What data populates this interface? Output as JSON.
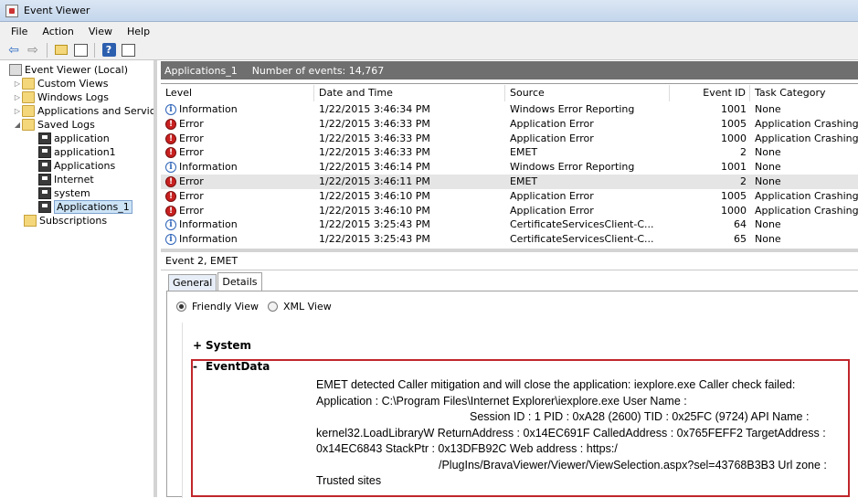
{
  "window": {
    "title": "Event Viewer"
  },
  "menu": [
    "File",
    "Action",
    "View",
    "Help"
  ],
  "toolbar": {
    "buttons": [
      "back-icon",
      "forward-icon",
      "folder-up-icon",
      "show-pane-icon",
      "help-icon",
      "properties-icon"
    ]
  },
  "tree": {
    "root": "Event Viewer (Local)",
    "custom_views": "Custom Views",
    "windows_logs": "Windows Logs",
    "app_services": "Applications and Services Lo",
    "saved_logs": "Saved Logs",
    "saved": [
      "application",
      "application1",
      "Applications",
      "Internet",
      "system",
      "Applications_1"
    ],
    "subscriptions": "Subscriptions"
  },
  "log": {
    "name": "Applications_1",
    "count_label": "Number of events: 14,767"
  },
  "columns": {
    "level": "Level",
    "datetime": "Date and Time",
    "source": "Source",
    "event_id": "Event ID",
    "task": "Task Category"
  },
  "rows": [
    {
      "level": "Information",
      "type": "info",
      "datetime": "1/22/2015 3:46:34 PM",
      "source": "Windows Error Reporting",
      "event_id": "1001",
      "task": "None"
    },
    {
      "level": "Error",
      "type": "error",
      "datetime": "1/22/2015 3:46:33 PM",
      "source": "Application Error",
      "event_id": "1005",
      "task": "Application Crashing Even"
    },
    {
      "level": "Error",
      "type": "error",
      "datetime": "1/22/2015 3:46:33 PM",
      "source": "Application Error",
      "event_id": "1000",
      "task": "Application Crashing Even"
    },
    {
      "level": "Error",
      "type": "error",
      "datetime": "1/22/2015 3:46:33 PM",
      "source": "EMET",
      "event_id": "2",
      "task": "None"
    },
    {
      "level": "Information",
      "type": "info",
      "datetime": "1/22/2015 3:46:14 PM",
      "source": "Windows Error Reporting",
      "event_id": "1001",
      "task": "None"
    },
    {
      "level": "Error",
      "type": "error",
      "datetime": "1/22/2015 3:46:11 PM",
      "source": "EMET",
      "event_id": "2",
      "task": "None",
      "selected": true
    },
    {
      "level": "Error",
      "type": "error",
      "datetime": "1/22/2015 3:46:10 PM",
      "source": "Application Error",
      "event_id": "1005",
      "task": "Application Crashing Even"
    },
    {
      "level": "Error",
      "type": "error",
      "datetime": "1/22/2015 3:46:10 PM",
      "source": "Application Error",
      "event_id": "1000",
      "task": "Application Crashing Even"
    },
    {
      "level": "Information",
      "type": "info",
      "datetime": "1/22/2015 3:25:43 PM",
      "source": "CertificateServicesClient-C...",
      "event_id": "64",
      "task": "None"
    },
    {
      "level": "Information",
      "type": "info",
      "datetime": "1/22/2015 3:25:43 PM",
      "source": "CertificateServicesClient-C...",
      "event_id": "65",
      "task": "None"
    }
  ],
  "detail": {
    "title": "Event 2, EMET",
    "tabs": [
      "General",
      "Details"
    ],
    "friendly_view": "Friendly View",
    "xml_view": "XML View",
    "system_sign": "+",
    "system_label": "System",
    "eventdata_sign": "-",
    "eventdata_label": "EventData",
    "lines": [
      "EMET detected Caller mitigation and will close the application: iexplore.exe Caller check failed:",
      "Application : C:\\Program Files\\Internet Explorer\\iexplore.exe User Name :",
      "Session ID : 1 PID : 0xA28 (2600) TID : 0x25FC (9724) API Name :",
      "kernel32.LoadLibraryW ReturnAddress : 0x14EC691F CalledAddress : 0x765FEFF2 TargetAddress :",
      "0x14EC6843 StackPtr : 0x13DFB92C Web address : https:/",
      "/PlugIns/BravaViewer/Viewer/ViewSelection.aspx?sel=43768B3B3 Url zone :",
      "Trusted sites"
    ]
  }
}
